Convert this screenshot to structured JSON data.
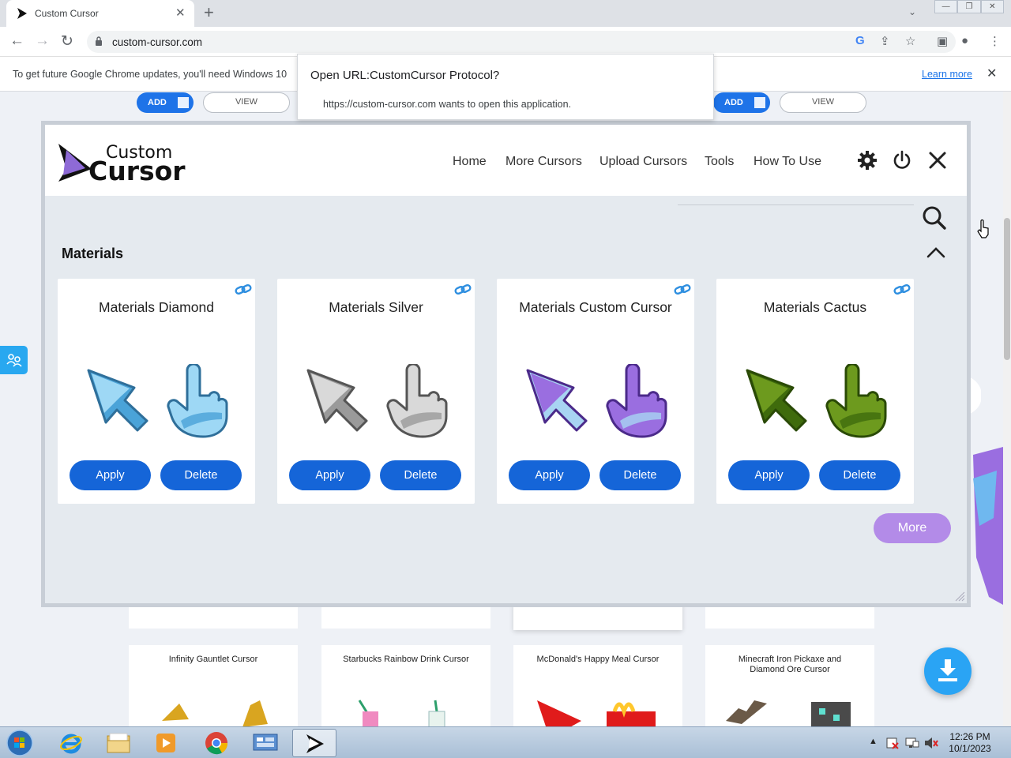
{
  "browser": {
    "tab_title": "Custom Cursor",
    "url": "custom-cursor.com",
    "infobar_message": "To get future Google Chrome updates, you'll need Windows 10",
    "infobar_link": "Learn more"
  },
  "protocol_dialog": {
    "title": "Open URL:CustomCursor Protocol?",
    "message": "https://custom-cursor.com wants to open this application."
  },
  "background_page": {
    "add_label": "ADD",
    "view_label": "VIEW",
    "cards": [
      "Infinity Gauntlet Cursor",
      "Starbucks Rainbow Drink Cursor",
      "McDonald's Happy Meal Cursor",
      "Minecraft Iron Pickaxe and Diamond Ore Cursor"
    ]
  },
  "popup": {
    "logo_line1": "Custom",
    "logo_line2": "Cursor",
    "nav": [
      "Home",
      "More Cursors",
      "Upload Cursors",
      "Tools",
      "How To Use"
    ],
    "section_title": "Materials",
    "apply_label": "Apply",
    "delete_label": "Delete",
    "more_label": "More",
    "cards": [
      {
        "name": "Materials Diamond",
        "main": "#9ed8f5",
        "shade": "#4aa3d8",
        "edge": "#2f6f9a"
      },
      {
        "name": "Materials Silver",
        "main": "#d9d9d9",
        "shade": "#9a9a9a",
        "edge": "#555555"
      },
      {
        "name": "Materials Custom Cursor",
        "main": "#9a6ee0",
        "shade": "#a8d4f2",
        "edge": "#4b2a8a"
      },
      {
        "name": "Materials Cactus",
        "main": "#6d9a1e",
        "shade": "#3f6b0c",
        "edge": "#2a4a06"
      }
    ]
  },
  "taskbar": {
    "time": "12:26 PM",
    "date": "10/1/2023"
  },
  "colors": {
    "primary_button": "#1565d8",
    "more_button": "#b38be8",
    "link_blue": "#1a73e8"
  }
}
